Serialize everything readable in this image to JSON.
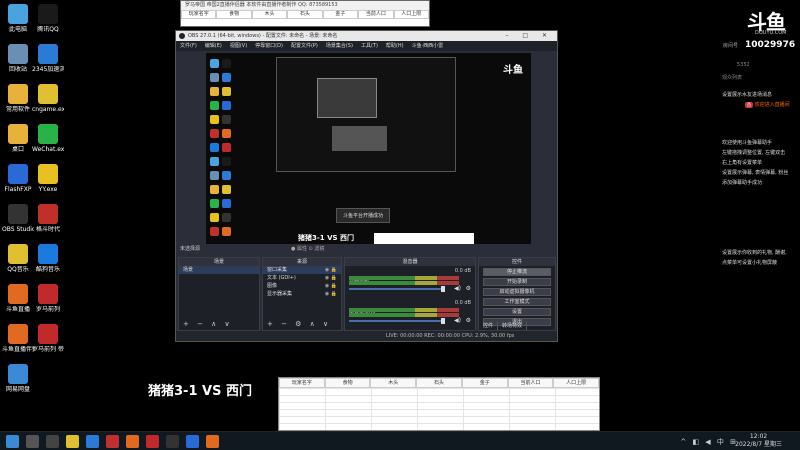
{
  "desktop_icons": [
    {
      "label": "此电脑",
      "color": "#4aa3df",
      "col": 0,
      "row": 0
    },
    {
      "label": "腾讯QQ",
      "color": "#1a1a1a",
      "col": 1,
      "row": 0
    },
    {
      "label": "回收站",
      "color": "#6a8fb4",
      "col": 0,
      "row": 1
    },
    {
      "label": "2345加速浏览器",
      "color": "#2a7ad6",
      "col": 1,
      "row": 1
    },
    {
      "label": "常用软件",
      "color": "#e8b23a",
      "col": 0,
      "row": 2
    },
    {
      "label": "cngame.exe",
      "color": "#e0c030",
      "col": 1,
      "row": 2
    },
    {
      "label": "桌口",
      "color": "#e8b23a",
      "col": 0,
      "row": 3
    },
    {
      "label": "WeChat.exe",
      "color": "#2ab24a",
      "col": 1,
      "row": 3
    },
    {
      "label": "FlashFXP",
      "color": "#2a6ad6",
      "col": 0,
      "row": 4
    },
    {
      "label": "YY.exe",
      "color": "#e8c020",
      "col": 1,
      "row": 4
    },
    {
      "label": "OBS Studio",
      "color": "#333333",
      "col": 0,
      "row": 5
    },
    {
      "label": "格斗时代",
      "color": "#c0302a",
      "col": 1,
      "row": 5
    },
    {
      "label": "QQ音乐",
      "color": "#e0c030",
      "col": 0,
      "row": 6
    },
    {
      "label": "酷狗音乐",
      "color": "#1a7ae0",
      "col": 1,
      "row": 6
    },
    {
      "label": "斗鱼直播",
      "color": "#e06a20",
      "col": 0,
      "row": 7
    },
    {
      "label": "罗马前列",
      "color": "#c02a2a",
      "col": 1,
      "row": 7
    },
    {
      "label": "斗鱼直播伴侣",
      "color": "#e06a20",
      "col": 0,
      "row": 8
    },
    {
      "label": "罗马前列 帝国2直播",
      "color": "#c02a2a",
      "col": 1,
      "row": 8
    },
    {
      "label": "网易网盘",
      "color": "#3a8ad6",
      "col": 0,
      "row": 9
    }
  ],
  "sheet_top": {
    "title": "罗马帝国 帝国2直播伴侣器   本软件由直播作者制作  QQ: 873589153",
    "headers": [
      "玩家名字",
      "食物",
      "木头",
      "石头",
      "金子",
      "当前人口",
      "人口上限"
    ]
  },
  "obs": {
    "title": "OBS 27.0.1 (64-bit, windows) - 配置文件: 未命名 - 场景: 未命名",
    "menu": [
      "文件(F)",
      "编辑(E)",
      "视图(V)",
      "停靠窗口(D)",
      "配置文件(P)",
      "场景集合(S)",
      "工具(T)",
      "帮助(H)",
      "斗鱼·西西小雷"
    ],
    "scene_bar": "未选择源",
    "scene_bar_filters": "● 属性   ⊙ 滤镜",
    "preview_label": "猪猪3-1 VS 西门",
    "preview_toast": "斗鱼平台开播成功",
    "preview_brand": "斗鱼",
    "scenes_header": "场景",
    "scenes": [
      "场景"
    ],
    "sources_header": "来源",
    "sources": [
      "窗口采集",
      "文本 (GDI+)",
      "图像",
      "显示器采集"
    ],
    "mixer_header": "混音器",
    "mixer": [
      {
        "name": "桌面音频",
        "db": "0.0 dB"
      },
      {
        "name": "麦克风/Aux",
        "db": "0.0 dB"
      }
    ],
    "controls_header": "控件",
    "controls": [
      "停止推流",
      "开始录制",
      "启动虚拟摄像机",
      "工作室模式",
      "设置",
      "退出"
    ],
    "tabs": [
      "控件",
      "转场特效"
    ],
    "status": "LIVE: 00:00:00    REC: 00:00:00    CPU: 2.9%, 30.00 fps"
  },
  "overlay": {
    "vs_label": "猪猪3-1 VS 西门",
    "sheet_headers": [
      "玩家名字",
      "食物",
      "木头",
      "石头",
      "金子",
      "当前人口",
      "人口上限"
    ]
  },
  "chat": {
    "brand": "斗鱼",
    "brand_sub": "DOUYU.COM",
    "room_label": "房间号",
    "room_number": "10029976",
    "fans": "5352",
    "tabs": "观众列表",
    "welcome": "欢迎进入直播间",
    "messages": [
      "设置展示水友进场消息",
      "欢迎使用斗鱼弹幕助手",
      "左键拖拽调整位置, 左键双击",
      "右上角有设置菜单",
      "设置展示弹幕, 表情弹幕, 粉丝",
      "添加弹幕助手成功",
      "设置展示你收到的礼物, 酬谢,",
      "点菜单可设置小礼物屏蔽"
    ]
  },
  "taskbar": {
    "time": "12:02",
    "date": "2022/8/7 星期三",
    "tray": "^ ◧ ◀ 中 ⊞"
  }
}
